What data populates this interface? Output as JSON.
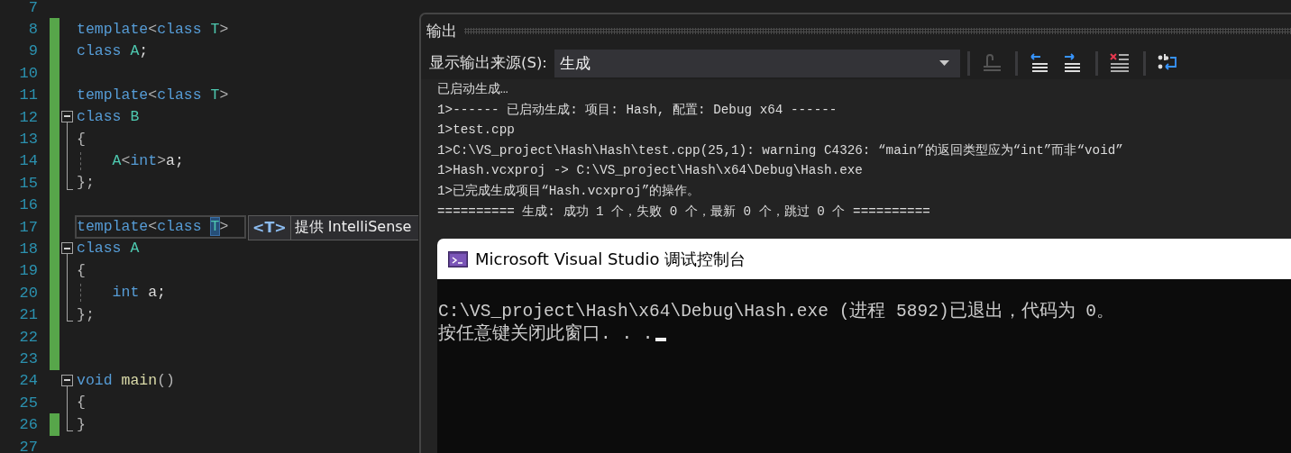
{
  "editor": {
    "lines": [
      {
        "number": "7",
        "changed": false,
        "current": false,
        "collapsible": false,
        "region_end": false,
        "indent_guide": false
      },
      {
        "number": "8",
        "changed": true,
        "current": false,
        "collapsible": false,
        "region_end": false,
        "indent_guide": false,
        "tokens": [
          {
            "text": "template",
            "kind": "keyword"
          },
          {
            "text": "<",
            "kind": "punct"
          },
          {
            "text": "class",
            "kind": "keyword"
          },
          {
            "text": " T",
            "kind": "type"
          },
          {
            "text": ">",
            "kind": "punct"
          }
        ]
      },
      {
        "number": "9",
        "changed": true,
        "current": false,
        "collapsible": false,
        "region_end": false,
        "indent_guide": false,
        "tokens": [
          {
            "text": "class",
            "kind": "keyword"
          },
          {
            "text": " A",
            "kind": "type"
          },
          {
            "text": ";",
            "kind": "plain"
          }
        ]
      },
      {
        "number": "10",
        "changed": true,
        "current": false,
        "collapsible": false,
        "region_end": false,
        "indent_guide": false
      },
      {
        "number": "11",
        "changed": true,
        "current": false,
        "collapsible": false,
        "region_end": false,
        "indent_guide": false,
        "tokens": [
          {
            "text": "template",
            "kind": "keyword"
          },
          {
            "text": "<",
            "kind": "punct"
          },
          {
            "text": "class",
            "kind": "keyword"
          },
          {
            "text": " T",
            "kind": "type"
          },
          {
            "text": ">",
            "kind": "punct"
          }
        ]
      },
      {
        "number": "12",
        "changed": true,
        "current": false,
        "collapsible": true,
        "region_end": false,
        "indent_guide": false,
        "tokens": [
          {
            "text": "class",
            "kind": "keyword"
          },
          {
            "text": " B",
            "kind": "type"
          }
        ]
      },
      {
        "number": "13",
        "changed": true,
        "current": false,
        "collapsible": false,
        "region_end": false,
        "indent_guide": false,
        "tokens": [
          {
            "text": "{",
            "kind": "punct"
          }
        ]
      },
      {
        "number": "14",
        "changed": true,
        "current": false,
        "collapsible": false,
        "region_end": false,
        "indent_guide": true,
        "tokens": [
          {
            "text": "    A",
            "kind": "type"
          },
          {
            "text": "<",
            "kind": "punct"
          },
          {
            "text": "int",
            "kind": "keyword"
          },
          {
            "text": ">",
            "kind": "punct"
          },
          {
            "text": "a;",
            "kind": "plain"
          }
        ]
      },
      {
        "number": "15",
        "changed": true,
        "current": false,
        "collapsible": false,
        "region_end": true,
        "indent_guide": false,
        "tokens": [
          {
            "text": "};",
            "kind": "punct"
          }
        ]
      },
      {
        "number": "16",
        "changed": true,
        "current": false,
        "collapsible": false,
        "region_end": false,
        "indent_guide": false
      },
      {
        "number": "17",
        "changed": true,
        "current": true,
        "collapsible": false,
        "region_end": false,
        "indent_guide": false,
        "tokens": [
          {
            "text": "template",
            "kind": "keyword"
          },
          {
            "text": "<",
            "kind": "punct"
          },
          {
            "text": "class ",
            "kind": "keyword"
          },
          {
            "text": "T",
            "kind": "selected"
          },
          {
            "text": ">",
            "kind": "punct"
          }
        ],
        "tooltip": {
          "badge": "<T>",
          "text": "提供 IntelliSense"
        }
      },
      {
        "number": "18",
        "changed": true,
        "current": false,
        "collapsible": true,
        "region_end": false,
        "indent_guide": false,
        "tokens": [
          {
            "text": "class",
            "kind": "keyword"
          },
          {
            "text": " A",
            "kind": "type"
          }
        ]
      },
      {
        "number": "19",
        "changed": true,
        "current": false,
        "collapsible": false,
        "region_end": false,
        "indent_guide": false,
        "tokens": [
          {
            "text": "{",
            "kind": "punct"
          }
        ]
      },
      {
        "number": "20",
        "changed": true,
        "current": false,
        "collapsible": false,
        "region_end": false,
        "indent_guide": true,
        "tokens": [
          {
            "text": "    int",
            "kind": "keyword"
          },
          {
            "text": " a;",
            "kind": "plain"
          }
        ]
      },
      {
        "number": "21",
        "changed": true,
        "current": false,
        "collapsible": false,
        "region_end": true,
        "indent_guide": false,
        "tokens": [
          {
            "text": "};",
            "kind": "punct"
          }
        ]
      },
      {
        "number": "22",
        "changed": true,
        "current": false,
        "collapsible": false,
        "region_end": false,
        "indent_guide": false
      },
      {
        "number": "23",
        "changed": true,
        "current": false,
        "collapsible": false,
        "region_end": false,
        "indent_guide": false
      },
      {
        "number": "24",
        "changed": false,
        "current": false,
        "collapsible": true,
        "region_end": false,
        "indent_guide": false,
        "tokens": [
          {
            "text": "void",
            "kind": "keyword"
          },
          {
            "text": " main",
            "kind": "func"
          },
          {
            "text": "()",
            "kind": "punct"
          }
        ]
      },
      {
        "number": "25",
        "changed": false,
        "current": false,
        "collapsible": false,
        "region_end": false,
        "indent_guide": false,
        "tokens": [
          {
            "text": "{",
            "kind": "punct"
          }
        ]
      },
      {
        "number": "26",
        "changed": true,
        "current": false,
        "collapsible": false,
        "region_end": true,
        "indent_guide": false,
        "tokens": [
          {
            "text": "}",
            "kind": "punct"
          }
        ]
      },
      {
        "number": "27",
        "changed": false,
        "current": false,
        "collapsible": false,
        "region_end": false,
        "indent_guide": false
      }
    ]
  },
  "output_panel": {
    "title": "输出",
    "source_label": "显示输出来源(S):",
    "source_value": "生成",
    "toolbar": [
      {
        "kind": "goto",
        "disabled": true,
        "separator_before": true
      },
      {
        "kind": "prev",
        "disabled": false,
        "separator_before": true
      },
      {
        "kind": "next",
        "disabled": false,
        "separator_before": false
      },
      {
        "kind": "clear",
        "disabled": false,
        "separator_before": true
      },
      {
        "kind": "wrap",
        "disabled": false,
        "separator_before": true
      }
    ],
    "lines": [
      "已启动生成…",
      "1>------ 已启动生成: 项目: Hash, 配置: Debug x64 ------",
      "1>test.cpp",
      "1>C:\\VS_project\\Hash\\Hash\\test.cpp(25,1): warning C4326: “main”的返回类型应为“int”而非“void”",
      "1>Hash.vcxproj -> C:\\VS_project\\Hash\\x64\\Debug\\Hash.exe",
      "1>已完成生成项目“Hash.vcxproj”的操作。",
      "========== 生成: 成功 1 个，失败 0 个，最新 0 个，跳过 0 个 =========="
    ]
  },
  "console": {
    "title": "Microsoft Visual Studio 调试控制台",
    "cursor": true,
    "lines": [
      "C:\\VS_project\\Hash\\x64\\Debug\\Hash.exe (进程 5892)已退出，代码为 0。",
      "按任意键关闭此窗口. . ."
    ]
  }
}
